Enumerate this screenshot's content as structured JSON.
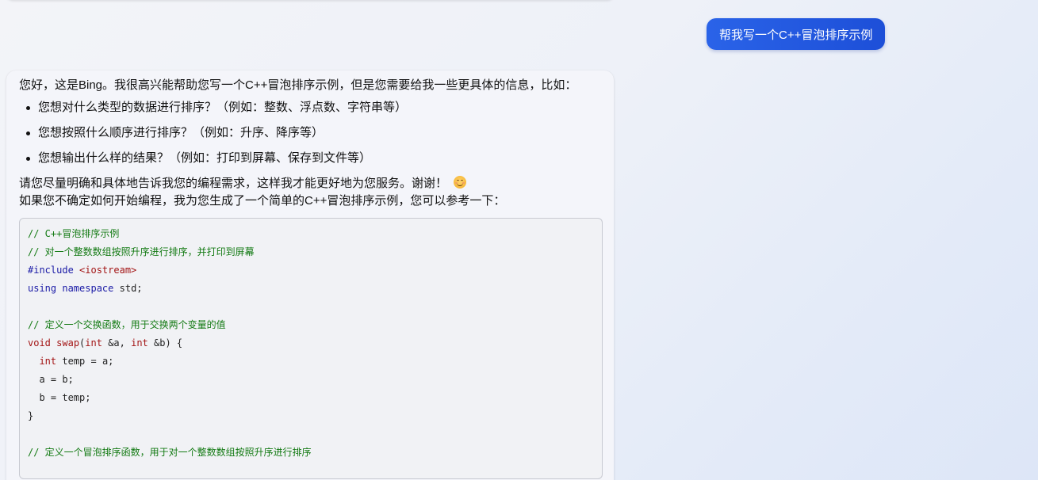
{
  "user_message": {
    "text": "帮我写一个C++冒泡排序示例"
  },
  "bot_message": {
    "intro": "您好，这是Bing。我很高兴能帮助您写一个C++冒泡排序示例，但是您需要给我一些更具体的信息，比如：",
    "bullets": [
      "您想对什么类型的数据进行排序？（例如：整数、浮点数、字符串等）",
      "您想按照什么顺序进行排序？（例如：升序、降序等）",
      "您想输出什么样的结果？（例如：打印到屏幕、保存到文件等）"
    ],
    "request": "请您尽量明确和具体地告诉我您的编程需求，这样我才能更好地为您服务。谢谢！",
    "emoji": "smiling-face-icon",
    "suggest": "如果您不确定如何开始编程，我为您生成了一个简单的C++冒泡排序示例，您可以参考一下：",
    "code": {
      "line1": "// C++冒泡排序示例",
      "line2": "// 对一个整数数组按照升序进行排序，并打印到屏幕",
      "line3_directive": "#include",
      "line3_header": "<iostream>",
      "line4_kw1": "using",
      "line4_kw2": "namespace",
      "line4_rest": " std;",
      "line6": "// 定义一个交换函数，用于交换两个变量的值",
      "line7_void": "void",
      "line7_fn": "swap",
      "line7_p1": "(",
      "line7_int1": "int",
      "line7_p2": " &a, ",
      "line7_int2": "int",
      "line7_p3": " &b) {",
      "line8_int": "int",
      "line8_rest": " temp = a;",
      "line9": "  a = b;",
      "line10": "  b = temp;",
      "line11": "}",
      "line13": "// 定义一个冒泡排序函数，用于对一个整数数组按照升序进行排序"
    }
  },
  "colors": {
    "user_bubble": "#1d4fd8",
    "code_comment": "#137a13",
    "code_keyword": "#1a1aa6",
    "code_type": "#a31515"
  }
}
